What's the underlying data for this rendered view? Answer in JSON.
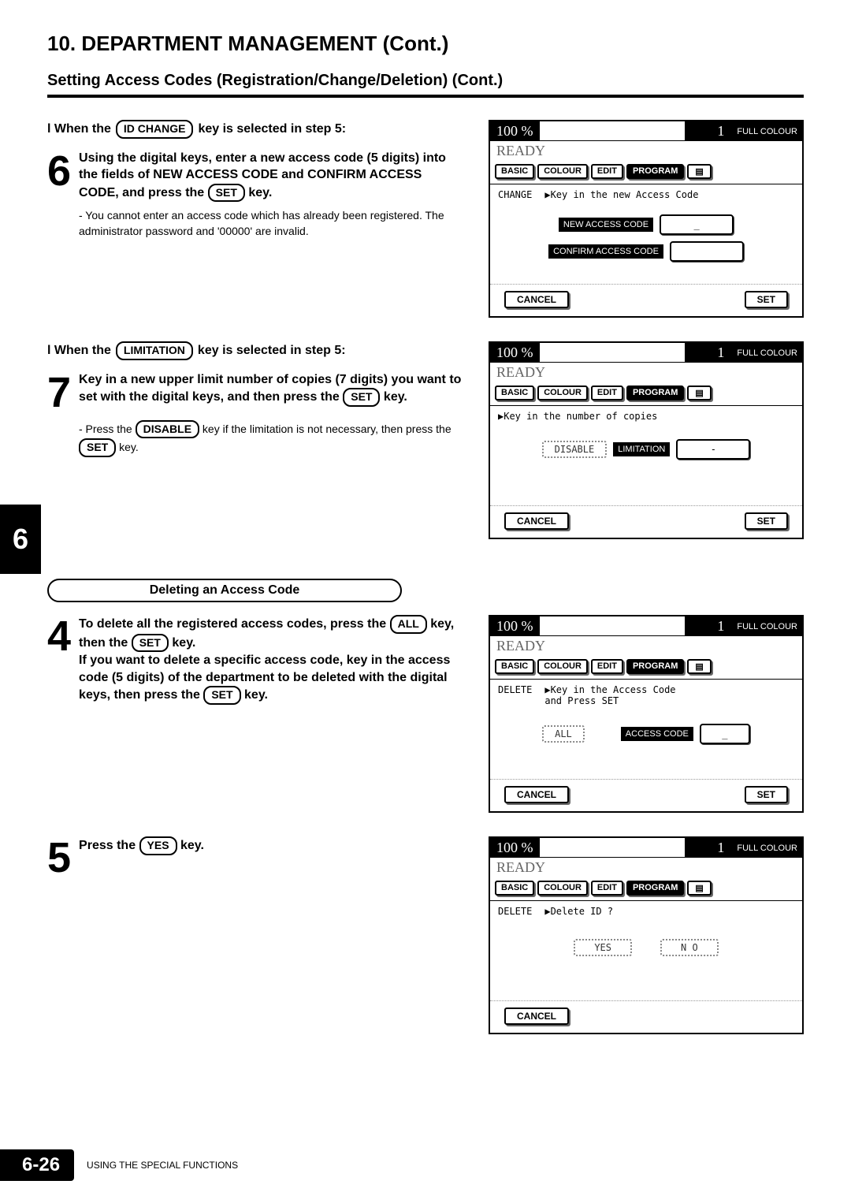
{
  "chapter": "10.  DEPARTMENT  MANAGEMENT  (Cont.)",
  "section": "Setting Access Codes (Registration/Change/Deletion) (Cont.)",
  "sidetab": "6",
  "footer": {
    "page": "6-26",
    "text": "USING THE SPECIAL FUNCTIONS"
  },
  "sub1_prefix": "l When the",
  "sub1_key": "ID CHANGE",
  "sub1_suffix": "key is selected in step 5:",
  "step6_num": "6",
  "step6_text_a": "Using the digital keys, enter a new access code (5 digits) into the fields of NEW ACCESS CODE and CONFIRM ACCESS CODE, and press the ",
  "step6_set": "SET",
  "step6_text_b": " key.",
  "step6_desc": "- You cannot enter an access code which has already been registered.  The administrator password and  '00000' are invalid.",
  "sub2_prefix": "l When the ",
  "sub2_key": "LIMITATION",
  "sub2_suffix": "key is selected in step 5:",
  "step7_num": "7",
  "step7_text_a": "Key in a new upper limit number of copies (7 digits) you want to set  with the digital keys, and then press the ",
  "step7_set": "SET",
  "step7_text_b": " key.",
  "step7_desc_a": "- Press the ",
  "step7_desc_key": "DISABLE",
  "step7_desc_b": " key if the limitation is not necessary, then press the ",
  "step7_desc_set": "SET",
  "step7_desc_c": " key.",
  "oval": "Deleting an Access Code",
  "step4_num": "4",
  "step4_text_a": "To delete all the registered access codes,  press the ",
  "step4_all": "ALL",
  "step4_text_b": " key, then the ",
  "step4_set": "SET",
  "step4_text_c": " key.",
  "step4_text2_a": "If you want to delete a specific access code,  key in the access code (5 digits) of the department to be deleted with the digital keys, then press the ",
  "step4_text2_set": "SET",
  "step4_text2_b": " key.",
  "step5_num": "5",
  "step5_text_a": "Press the ",
  "step5_key": "YES",
  "step5_text_b": " key.",
  "screen_common": {
    "zoom": "100  %",
    "counter": "1",
    "mode": "FULL COLOUR",
    "ready": "READY",
    "tabs": {
      "basic": "BASIC",
      "colour": "COLOUR",
      "edit": "EDIT",
      "program": "PROGRAM"
    },
    "cancel": "CANCEL",
    "set": "SET"
  },
  "screen1": {
    "left_label": "CHANGE",
    "prompt": "▶Key in the new Access Code",
    "field1": "NEW ACCESS CODE",
    "field2": "CONFIRM ACCESS CODE",
    "placeholder": "_"
  },
  "screen2": {
    "prompt": "▶Key in the number of copies",
    "btn_disable": "DISABLE",
    "btn_limitation": "LIMITATION",
    "placeholder": "-"
  },
  "screen3": {
    "left_label": "DELETE",
    "prompt": "▶Key in the Access Code\nand Press SET",
    "btn_all": "ALL",
    "field": "ACCESS CODE",
    "placeholder": "_"
  },
  "screen4": {
    "left_label": "DELETE",
    "prompt": "▶Delete ID ?",
    "yes": "YES",
    "no": "N O"
  }
}
